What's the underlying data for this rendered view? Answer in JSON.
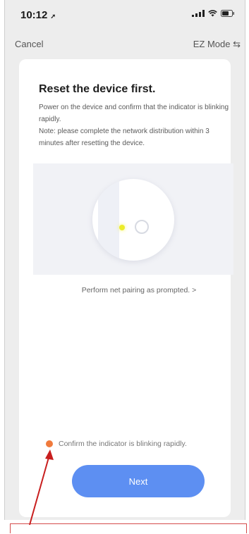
{
  "status_bar": {
    "time": "10:12",
    "location_glyph": "➚",
    "signal_icon": "signal-icon",
    "wifi_icon": "wifi-icon",
    "battery_icon": "battery-icon"
  },
  "nav": {
    "cancel_label": "Cancel",
    "mode_label": "EZ Mode ⇆"
  },
  "card": {
    "title": "Reset the device first.",
    "description_lines": [
      "Power on the device and confirm that the indicator is blinking rapidly.",
      "Note: please complete the network distribution within 3 minutes after resetting the device."
    ],
    "pairing_link": "Perform net pairing as prompted. >"
  },
  "confirm": {
    "label": "Confirm the indicator is blinking rapidly.",
    "checked": true
  },
  "next_button_label": "Next",
  "colors": {
    "accent": "#5d8ff2",
    "check": "#f07a3c",
    "indicator": "#ecec2a",
    "annotation": "#c81e1e"
  }
}
